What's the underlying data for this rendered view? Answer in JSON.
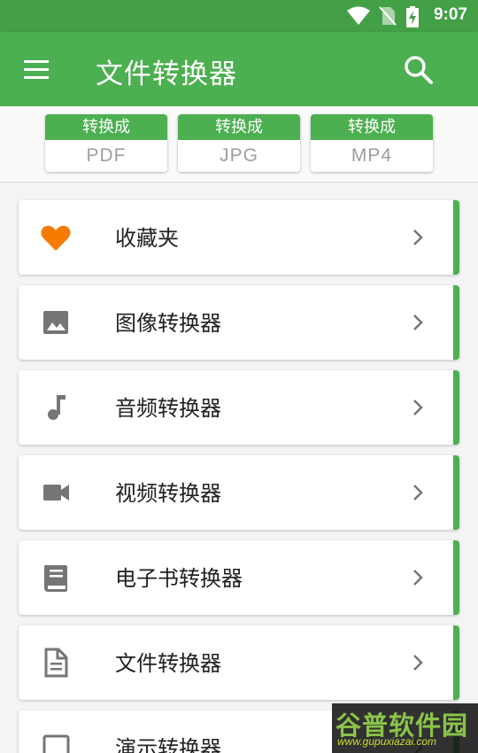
{
  "status_bar": {
    "time": "9:07",
    "icons": [
      "wifi-icon",
      "no-sim-icon",
      "battery-charging-icon"
    ]
  },
  "app_bar": {
    "title": "文件转换器",
    "menu_icon": "menu-icon",
    "search_icon": "search-icon"
  },
  "quick_convert": [
    {
      "prefix": "转换成",
      "format": "PDF"
    },
    {
      "prefix": "转换成",
      "format": "JPG"
    },
    {
      "prefix": "转换成",
      "format": "MP4"
    }
  ],
  "menu_items": [
    {
      "label": "收藏夹",
      "icon": "heart-icon",
      "icon_color": "#f57c00"
    },
    {
      "label": "图像转换器",
      "icon": "image-icon",
      "icon_color": "#757575"
    },
    {
      "label": "音频转换器",
      "icon": "music-note-icon",
      "icon_color": "#757575"
    },
    {
      "label": "视频转换器",
      "icon": "video-camera-icon",
      "icon_color": "#757575"
    },
    {
      "label": "电子书转换器",
      "icon": "book-icon",
      "icon_color": "#757575"
    },
    {
      "label": "文件转换器",
      "icon": "document-icon",
      "icon_color": "#757575"
    },
    {
      "label": "演示转换器",
      "icon": "presentation-icon",
      "icon_color": "#757575"
    }
  ],
  "colors": {
    "primary": "#4caf50",
    "status_bar": "#43a047",
    "accent": "#f57c00",
    "icon_gray": "#757575"
  },
  "watermark": {
    "main": "谷普软件园",
    "sub": "www.gupuxiazai.com"
  }
}
